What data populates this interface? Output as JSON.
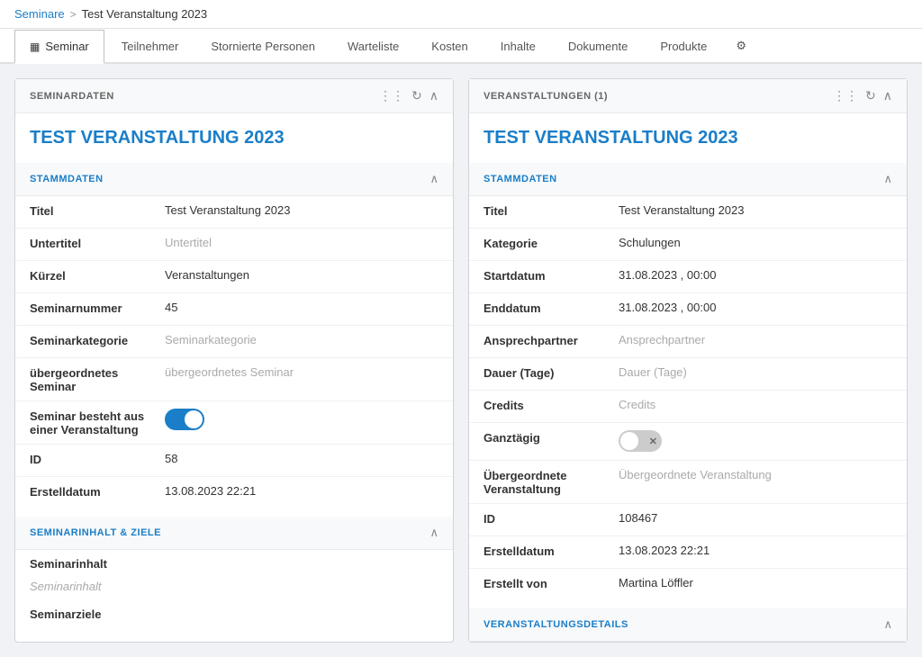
{
  "breadcrumb": {
    "link": "Seminare",
    "separator": ">",
    "current": "Test Veranstaltung 2023"
  },
  "tabs": [
    {
      "id": "seminar",
      "label": "Seminar",
      "icon": "▦",
      "active": true
    },
    {
      "id": "teilnehmer",
      "label": "Teilnehmer",
      "active": false
    },
    {
      "id": "stornierte",
      "label": "Stornierte Personen",
      "active": false
    },
    {
      "id": "warteliste",
      "label": "Warteliste",
      "active": false
    },
    {
      "id": "kosten",
      "label": "Kosten",
      "active": false
    },
    {
      "id": "inhalte",
      "label": "Inhalte",
      "active": false
    },
    {
      "id": "dokumente",
      "label": "Dokumente",
      "active": false
    },
    {
      "id": "produkte",
      "label": "Produkte",
      "active": false
    },
    {
      "id": "settings",
      "label": "⚙",
      "active": false
    }
  ],
  "left_panel": {
    "header": "SEMINARDATEN",
    "title": "TEST VERANSTALTUNG 2023",
    "stammdaten_label": "STAMMDATEN",
    "fields": [
      {
        "label": "Titel",
        "value": "Test Veranstaltung 2023",
        "placeholder": false
      },
      {
        "label": "Untertitel",
        "value": "Untertitel",
        "placeholder": true
      },
      {
        "label": "Kürzel",
        "value": "Veranstaltungen",
        "placeholder": false
      },
      {
        "label": "Seminarnummer",
        "value": "45",
        "placeholder": false
      },
      {
        "label": "Seminarkategorie",
        "value": "Seminarkategorie",
        "placeholder": true
      }
    ],
    "field_uebergeordnetes": {
      "label": "übergeordnetes Seminar",
      "value": "übergeordnetes Seminar",
      "placeholder": true
    },
    "field_besteht": {
      "label": "Seminar besteht aus einer Veranstaltung",
      "toggle": true
    },
    "field_id": {
      "label": "ID",
      "value": "58"
    },
    "field_erstelldatum": {
      "label": "Erstelldatum",
      "value": "13.08.2023 22:21"
    },
    "seminarinhalt_label": "SEMINARINHALT & ZIELE",
    "seminarinhalt_field_label": "Seminarinhalt",
    "seminarinhalt_placeholder": "Seminarinhalt",
    "seminarziele_label": "Seminarziele"
  },
  "right_panel": {
    "header": "VERANSTALTUNGEN (1)",
    "title": "TEST VERANSTALTUNG 2023",
    "stammdaten_label": "STAMMDATEN",
    "fields": [
      {
        "label": "Titel",
        "value": "Test Veranstaltung 2023",
        "placeholder": false
      },
      {
        "label": "Kategorie",
        "value": "Schulungen",
        "placeholder": false
      },
      {
        "label": "Startdatum",
        "value": "31.08.2023 ,  00:00",
        "placeholder": false
      },
      {
        "label": "Enddatum",
        "value": "31.08.2023 ,  00:00",
        "placeholder": false
      },
      {
        "label": "Ansprechpartner",
        "value": "Ansprechpartner",
        "placeholder": true
      },
      {
        "label": "Dauer (Tage)",
        "value": "Dauer (Tage)",
        "placeholder": true
      },
      {
        "label": "Credits",
        "value": "Credits",
        "placeholder": true
      }
    ],
    "field_ganztagig": {
      "label": "Ganztägig",
      "toggle_off": true
    },
    "field_uebergeordnete": {
      "label": "Übergeordnete Veranstaltung",
      "value": "Übergeordnete Veranstaltung",
      "placeholder": true
    },
    "field_id": {
      "label": "ID",
      "value": "108467"
    },
    "field_erstelldatum": {
      "label": "Erstelldatum",
      "value": "13.08.2023 22:21"
    },
    "field_erstellt_von": {
      "label": "Erstellt von",
      "value": "Martina Löffler"
    },
    "veranstaltungsdetails_label": "VERANSTALTUNGSDETAILS"
  }
}
